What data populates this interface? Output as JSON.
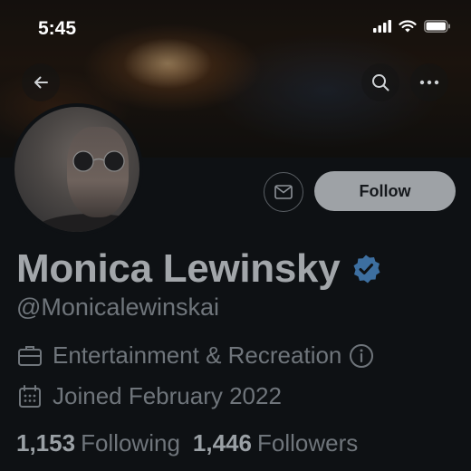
{
  "status_bar": {
    "time": "5:45"
  },
  "header": {
    "back_icon": "arrow-left-icon",
    "search_icon": "search-icon",
    "more_icon": "more-horizontal-icon"
  },
  "profile": {
    "display_name": "Monica Lewinsky",
    "handle": "@Monicalewinskai",
    "verified": true,
    "category": "Entertainment & Recreation",
    "joined": "Joined February 2022",
    "following_count": "1,153",
    "following_label": "Following",
    "followers_count": "1,446",
    "followers_label": "Followers"
  },
  "actions": {
    "message_icon": "mail-icon",
    "follow_label": "Follow"
  },
  "colors": {
    "background": "#0e1114",
    "follow_button": "#9ea2a6",
    "verified_badge": "#3d6fa0"
  }
}
